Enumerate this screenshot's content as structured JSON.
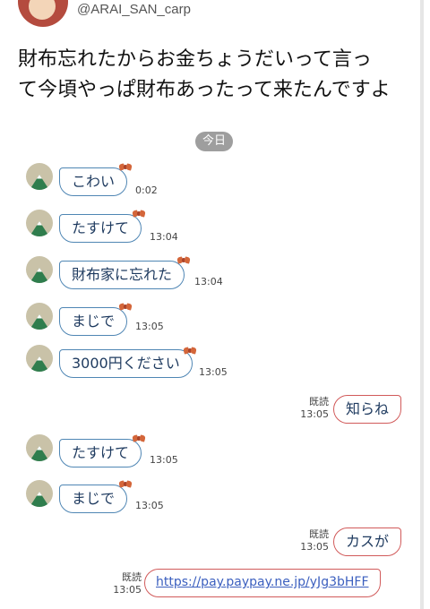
{
  "header": {
    "handle": "@ARAI_SAN_carp"
  },
  "tweet": {
    "text_line1": "財布忘れたからお金ちょうだいって言っ",
    "text_line2": "て今頃やっぱ財布あったって来たんですよ"
  },
  "chat": {
    "date_label": "今日",
    "read_label": "既読",
    "messages": [
      {
        "side": "in",
        "text": "こわい",
        "time": "0:02"
      },
      {
        "side": "in",
        "text": "たすけて",
        "time": "13:04"
      },
      {
        "side": "in",
        "text": "財布家に忘れた",
        "time": "13:04"
      },
      {
        "side": "in",
        "text": "まじで",
        "time": "13:05"
      },
      {
        "side": "in",
        "text": "3000円ください",
        "time": "13:05"
      },
      {
        "side": "out",
        "text": "知らね",
        "time": "13:05"
      },
      {
        "side": "in",
        "text": "たすけて",
        "time": "13:05"
      },
      {
        "side": "in",
        "text": "まじで",
        "time": "13:05"
      },
      {
        "side": "out",
        "text": "カスが",
        "time": "13:05"
      },
      {
        "side": "out",
        "text": "https://pay.paypay.ne.jp/yJg3bHFF",
        "time": "13:05"
      }
    ]
  },
  "colors": {
    "incoming_border": "#4f86b4",
    "outgoing_border": "#d15a5a",
    "date_chip": "#9e9e9e",
    "link": "#3b5fbf"
  },
  "icons": {
    "sender_avatar": "mountain-avatar-icon",
    "bubble_decoration": "ribbon-bow-icon"
  }
}
